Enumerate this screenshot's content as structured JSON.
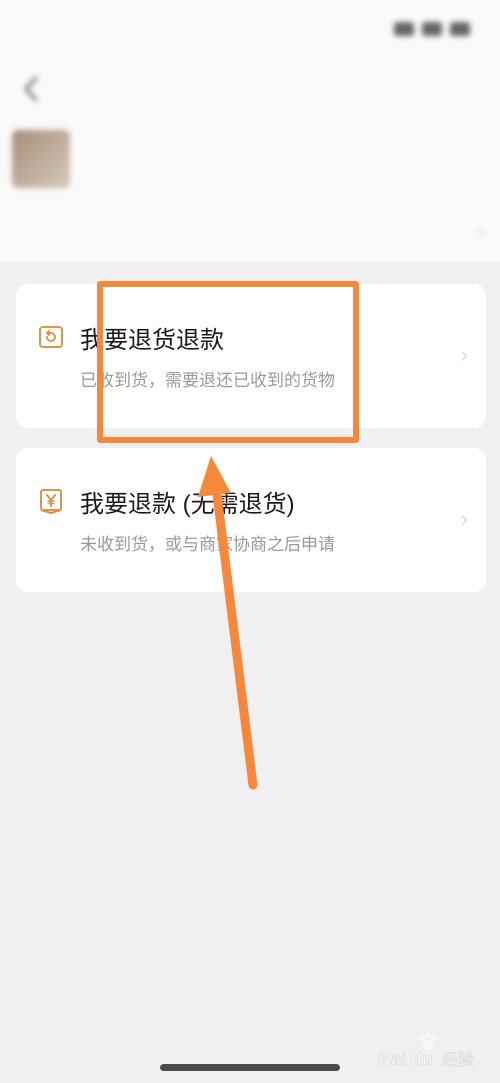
{
  "status_bar": {
    "time": "",
    "icons": [
      "signal-icon",
      "wifi-icon",
      "battery-icon"
    ]
  },
  "nav": {
    "title": "",
    "back_icon": "chevron-left-icon"
  },
  "product": {
    "name": "",
    "desc": ""
  },
  "select_row": {
    "label": ""
  },
  "options": [
    {
      "icon": "return-box-icon",
      "title": "我要退货退款",
      "subtitle": "已收到货，需要退还已收到的货物"
    },
    {
      "icon": "yuan-refund-icon",
      "title": "我要退款 (无需退货)",
      "subtitle": "未收到货，或与商家协商之后申请"
    }
  ],
  "colors": {
    "accent": "#f5883a",
    "icon_color": "#d9954d"
  },
  "watermark": {
    "logo": "Bai du",
    "label": "经验"
  }
}
